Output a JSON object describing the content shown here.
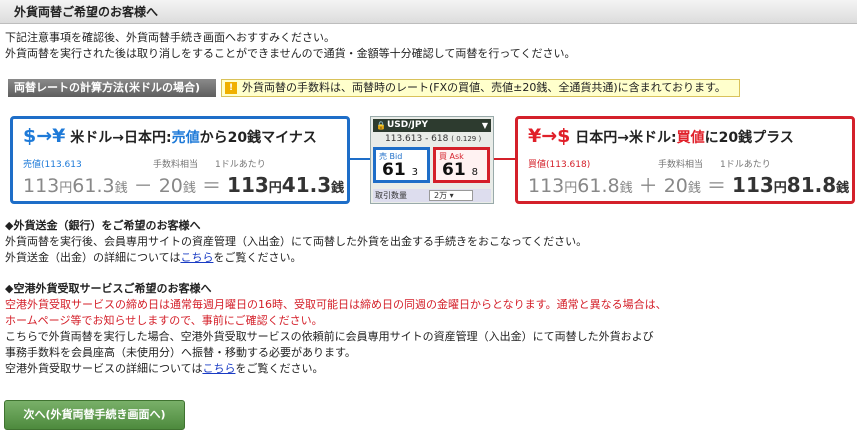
{
  "header": {
    "title": "外貨両替ご希望のお客様へ"
  },
  "intro": {
    "line1": "下記注意事項を確認後、外貨両替手続き画面へおすすみください。",
    "line2": "外貨両替を実行された後は取り消しをすることができませんので通貨・金額等十分確認して両替を行ってください。"
  },
  "rate": {
    "title": "両替レートの計算方法(米ドルの場合)",
    "notice": "外貨両替の手数料は、両替時のレート(FXの買値、売値±20銭、全通貨共通)に含まれております。"
  },
  "left_box": {
    "symbols": "$→¥",
    "direction": "米ドル→日本円:",
    "key": "売値",
    "rest": "から20銭マイナス",
    "label_rate": "売値(113.613",
    "label_fee": "手数料相当",
    "label_per": "1ドルあたり",
    "v1": "113",
    "u1": "円",
    "v2": "61.3",
    "u2": "銭",
    "op": "－",
    "v3": "20",
    "u3": "銭",
    "eq": "＝",
    "r1": "113",
    "ru1": "円",
    "r2": "41.3",
    "ru2": "銭"
  },
  "right_box": {
    "symbols": "¥→$",
    "direction": "日本円→米ドル:",
    "key": "買値",
    "rest": "に20銭プラス",
    "label_rate": "買値(113.618)",
    "label_fee": "手数料相当",
    "label_per": "1ドルあたり",
    "v1": "113",
    "u1": "円",
    "v2": "61.8",
    "u2": "銭",
    "op": "＋",
    "v3": "20",
    "u3": "銭",
    "eq": "＝",
    "r1": "113",
    "ru1": "円",
    "r2": "81.8",
    "ru2": "銭"
  },
  "widget": {
    "pair": "USD/JPY",
    "quote": "113.613 - 618",
    "spread": "( 0.129 )",
    "bid_label": "売 Bid",
    "bid_big": "61",
    "bid_small": "3",
    "ask_label": "買 Ask",
    "ask_big": "61",
    "ask_small": "8",
    "qty_label": "取引数量",
    "qty_value": "2万"
  },
  "remit": {
    "title": "◆外貨送金（銀行）をご希望のお客様へ",
    "line1": "外貨両替を実行後、会員専用サイトの資産管理（入出金）にて両替した外貨を出金する手続きをおこなってください。",
    "line2_pre": "外貨送金（出金）の詳細については",
    "link": "こちら",
    "line2_post": "をご覧ください。"
  },
  "airport": {
    "title": "◆空港外貨受取サービスご希望のお客様へ",
    "red1": "空港外貨受取サービスの締め日は通常毎週月曜日の16時、受取可能日は締め日の同週の金曜日からとなります。通常と異なる場合は、",
    "red2": "ホームページ等でお知らせしますので、事前にご確認ください。",
    "line3": "こちらで外貨両替を実行した場合、空港外貨受取サービスの依頼前に会員専用サイトの資産管理（入出金）にて両替した外貨および",
    "line4": "事務手数料を会員座高（未使用分）へ振替・移動する必要があります。",
    "line5_pre": "空港外貨受取サービスの詳細については",
    "link": "こちら",
    "line5_post": "をご覧ください。"
  },
  "next_button": "次へ(外貨両替手続き画面へ)"
}
